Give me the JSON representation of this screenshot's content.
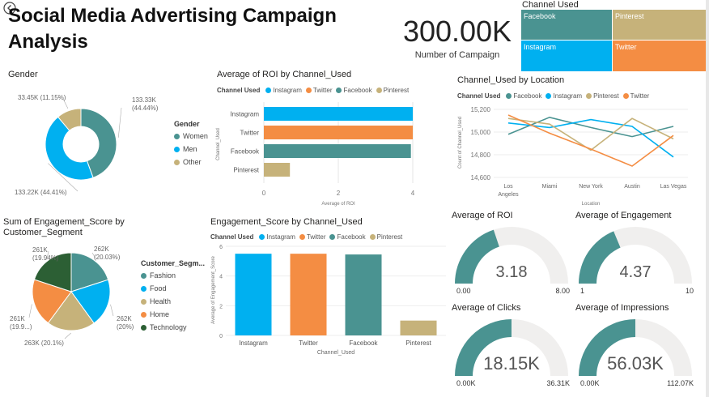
{
  "page": {
    "title": "Social Media Advertising Campaign Analysis"
  },
  "kpi": {
    "value": "300.00K",
    "label": "Number of Campaign"
  },
  "colors": {
    "teal": "#4A9391",
    "blue": "#00B0F0",
    "orange": "#F48D43",
    "tan": "#C6B27A",
    "green": "#2C5F34",
    "gray": "#F0EFEE"
  },
  "treemap": {
    "title": "Channel Used",
    "tiles": [
      {
        "label": "Facebook",
        "color": "#4A9391"
      },
      {
        "label": "Pinterest",
        "color": "#C6B27A"
      },
      {
        "label": "Instagram",
        "color": "#00B0F0"
      },
      {
        "label": "Twitter",
        "color": "#F48D43"
      }
    ]
  },
  "chart_data": [
    {
      "id": "gender",
      "type": "pie",
      "title": "Gender",
      "legend_title": "Gender",
      "categories": [
        "Women",
        "Men",
        "Other"
      ],
      "values": [
        133.33,
        133.22,
        33.45
      ],
      "labels": [
        "133.33K (44.44%)",
        "133.22K (44.41%)",
        "33.45K (11.15%)"
      ],
      "colors": [
        "#4A9391",
        "#00B0F0",
        "#C6B27A"
      ],
      "donut": true
    },
    {
      "id": "roi",
      "type": "bar",
      "orientation": "horizontal",
      "title": "Average of ROI by Channel_Used",
      "legend_title": "Channel Used",
      "legend": [
        "Instagram",
        "Twitter",
        "Facebook",
        "Pinterest"
      ],
      "categories": [
        "Instagram",
        "Twitter",
        "Facebook",
        "Pinterest"
      ],
      "values": [
        4.0,
        4.0,
        3.95,
        0.7
      ],
      "colors": [
        "#00B0F0",
        "#F48D43",
        "#4A9391",
        "#C6B27A"
      ],
      "xlabel": "Average of ROI",
      "ylabel": "Channel_Used",
      "xlim": [
        0,
        4
      ],
      "xticks": [
        "0",
        "2",
        "4"
      ]
    },
    {
      "id": "location",
      "type": "line",
      "title": "Channel_Used by Location",
      "legend_title": "Channel Used",
      "legend": [
        "Facebook",
        "Instagram",
        "Pinterest",
        "Twitter"
      ],
      "categories": [
        "Los Angeles",
        "Miami",
        "New York",
        "Austin",
        "Las Vegas"
      ],
      "series": [
        {
          "name": "Facebook",
          "color": "#4A9391",
          "values": [
            14980,
            15130,
            15040,
            14960,
            15050
          ]
        },
        {
          "name": "Instagram",
          "color": "#00B0F0",
          "values": [
            15080,
            15040,
            15110,
            15050,
            14780
          ]
        },
        {
          "name": "Pinterest",
          "color": "#C6B27A",
          "values": [
            15120,
            15070,
            14840,
            15120,
            14940
          ]
        },
        {
          "name": "Twitter",
          "color": "#F48D43",
          "values": [
            15150,
            14990,
            14850,
            14700,
            14970
          ]
        }
      ],
      "xlabel": "Location",
      "ylabel": "Count of Channel_Used",
      "ylim": [
        14550,
        15250
      ],
      "yticks": [
        14600,
        14800,
        15000,
        15200
      ],
      "ytick_labels": [
        "14,600",
        "14,800",
        "15,000",
        "15,200"
      ]
    },
    {
      "id": "segment",
      "type": "pie",
      "title": "Sum of Engagement_Score by Customer_Segment",
      "legend_title": "Customer_Segm...",
      "categories": [
        "Fashion",
        "Food",
        "Health",
        "Home",
        "Technology"
      ],
      "values": [
        262,
        262,
        263,
        261,
        261
      ],
      "labels": [
        "262K (20.03%)",
        "262K (20%)",
        "263K (20.1%)",
        "261K (19.9...)",
        "261K (19.94%)"
      ],
      "colors": [
        "#4A9391",
        "#00B0F0",
        "#C6B27A",
        "#F48D43",
        "#2C5F34"
      ]
    },
    {
      "id": "engagement",
      "type": "bar",
      "orientation": "vertical",
      "title": "Engagement_Score by Channel_Used",
      "legend_title": "Channel Used",
      "legend": [
        "Instagram",
        "Twitter",
        "Facebook",
        "Pinterest"
      ],
      "categories": [
        "Instagram",
        "Twitter",
        "Facebook",
        "Pinterest"
      ],
      "values": [
        5.5,
        5.5,
        5.45,
        1.0
      ],
      "colors": [
        "#00B0F0",
        "#F48D43",
        "#4A9391",
        "#C6B27A"
      ],
      "xlabel": "Channel_Used",
      "ylabel": "Average of Engagement_Score",
      "ylim": [
        0,
        6
      ],
      "yticks": [
        "0",
        "2",
        "4",
        "6"
      ]
    }
  ],
  "gauges": [
    {
      "id": "g-roi",
      "title": "Average of ROI",
      "value": 3.18,
      "min": 0,
      "max": 8,
      "value_label": "3.18",
      "min_label": "0.00",
      "max_label": "8.00"
    },
    {
      "id": "g-eng",
      "title": "Average of Engagement",
      "value": 4.37,
      "min": 1,
      "max": 10,
      "value_label": "4.37",
      "min_label": "1",
      "max_label": "10"
    },
    {
      "id": "g-clicks",
      "title": "Average of Clicks",
      "value": 18.15,
      "min": 0,
      "max": 36.31,
      "value_label": "18.15K",
      "min_label": "0.00K",
      "max_label": "36.31K"
    },
    {
      "id": "g-impr",
      "title": "Average of Impressions",
      "value": 56.03,
      "min": 0,
      "max": 112.07,
      "value_label": "56.03K",
      "min_label": "0.00K",
      "max_label": "112.07K"
    }
  ]
}
